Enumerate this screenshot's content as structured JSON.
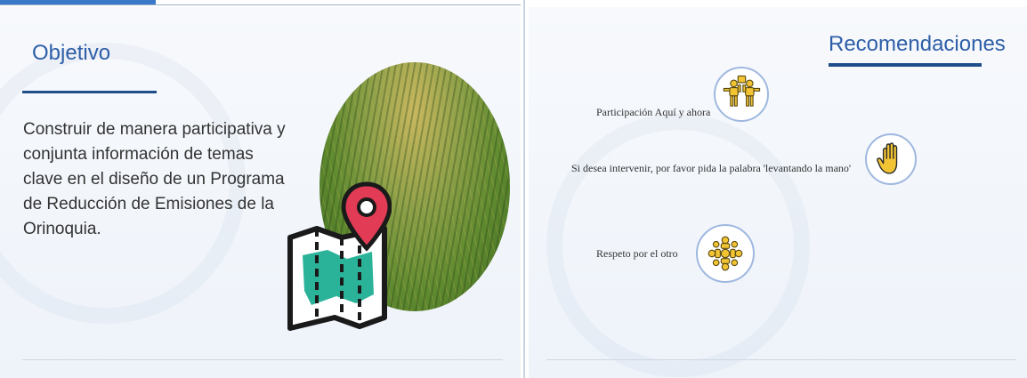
{
  "left_slide": {
    "title": "Objetivo",
    "body": "Construir de manera participativa y conjunta información de temas clave en el diseño de un Programa de Reducción de Emisiones de la Orinoquia.",
    "image_name": "rice-field-photo",
    "icon_name": "map-pin-icon"
  },
  "right_slide": {
    "title": "Recomendaciones",
    "items": [
      {
        "label": "Participación Aquí y ahora",
        "icon": "people-puzzle-icon"
      },
      {
        "label": "Si desea intervenir, por favor pida la palabra 'levantando la mano'",
        "icon": "raised-hand-icon"
      },
      {
        "label": "Respeto por el otro",
        "icon": "people-circle-icon"
      }
    ]
  },
  "colors": {
    "title": "#2e5ea8",
    "underline": "#1f4e8a",
    "icon_gold": "#f2c434",
    "map_teal": "#2bb39a",
    "pin_red": "#e23b55"
  }
}
